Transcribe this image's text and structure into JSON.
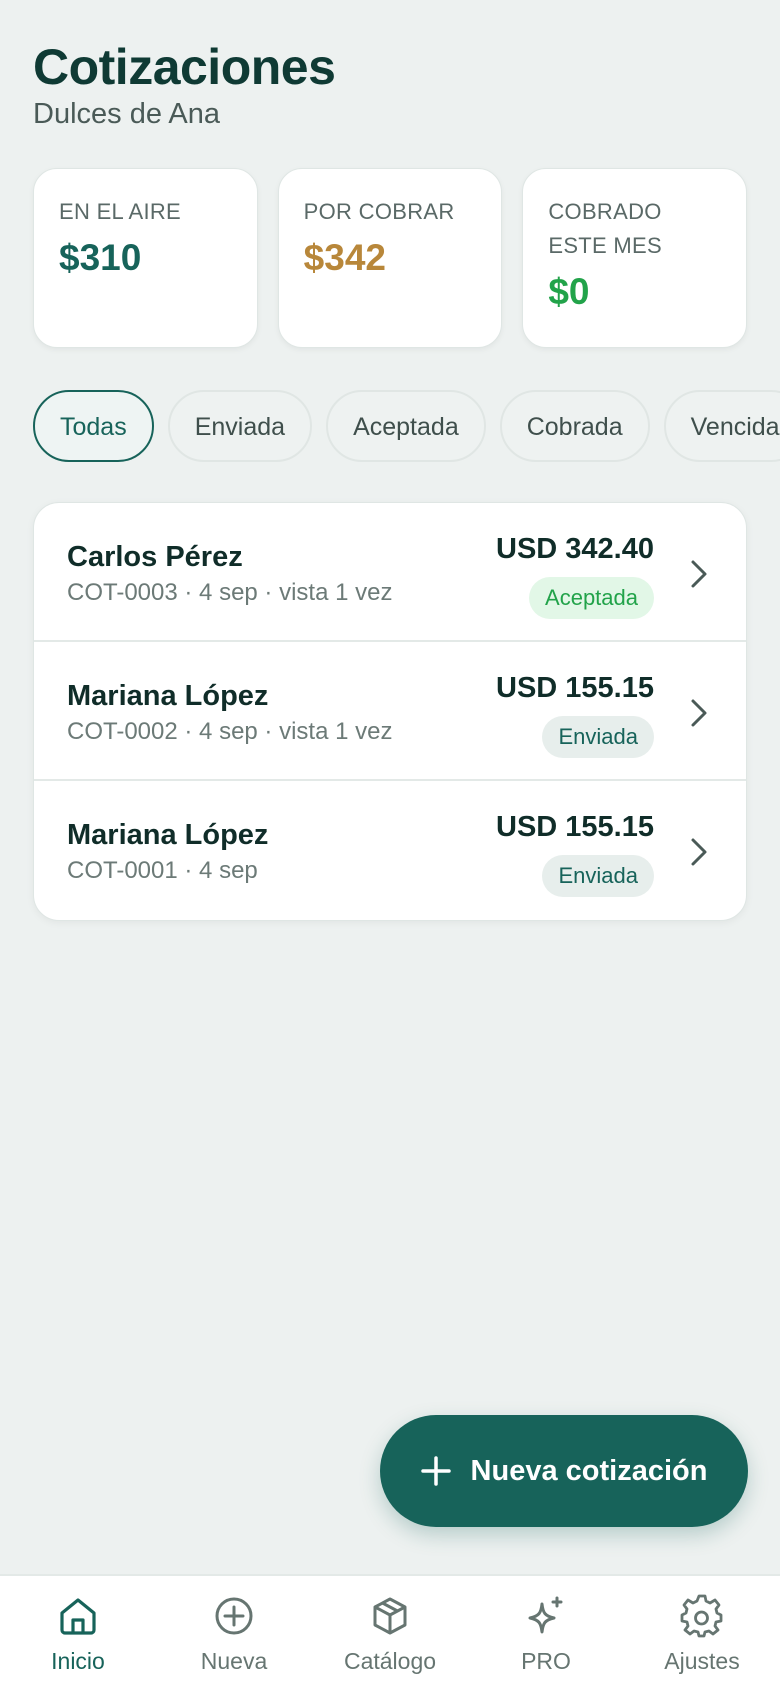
{
  "header": {
    "title": "Cotizaciones",
    "subtitle": "Dulces de Ana"
  },
  "stats": [
    {
      "label": "EN EL AIRE",
      "value": "$310",
      "color": "#17635a"
    },
    {
      "label": "POR COBRAR",
      "value": "$342",
      "color": "#b8873a"
    },
    {
      "label": "COBRADO ESTE MES",
      "value": "$0",
      "color": "#22a34a"
    }
  ],
  "filters": {
    "chips": [
      "Todas",
      "Enviada",
      "Aceptada",
      "Cobrada",
      "Vencida"
    ],
    "active": "Todas"
  },
  "quotes": [
    {
      "client": "Carlos Pérez",
      "meta": "COT-0003 · 4 sep · vista 1 vez",
      "amount": "USD 342.40",
      "status": "Aceptada"
    },
    {
      "client": "Mariana López",
      "meta": "COT-0002 · 4 sep · vista 1 vez",
      "amount": "USD 155.15",
      "status": "Enviada"
    },
    {
      "client": "Mariana López",
      "meta": "COT-0001 · 4 sep",
      "amount": "USD 155.15",
      "status": "Enviada"
    }
  ],
  "fab": {
    "label": "Nueva cotización",
    "icon": "plus-icon"
  },
  "nav": [
    {
      "label": "Inicio",
      "icon": "home-icon",
      "active": true
    },
    {
      "label": "Nueva",
      "icon": "plus-circle-icon",
      "active": false
    },
    {
      "label": "Catálogo",
      "icon": "box-icon",
      "active": false
    },
    {
      "label": "PRO",
      "icon": "sparkle-icon",
      "active": false
    },
    {
      "label": "Ajustes",
      "icon": "gear-icon",
      "active": false
    }
  ],
  "colors": {
    "accent": "#17635a",
    "gold": "#b8873a",
    "success": "#22a34a",
    "background": "#edf1f0"
  }
}
